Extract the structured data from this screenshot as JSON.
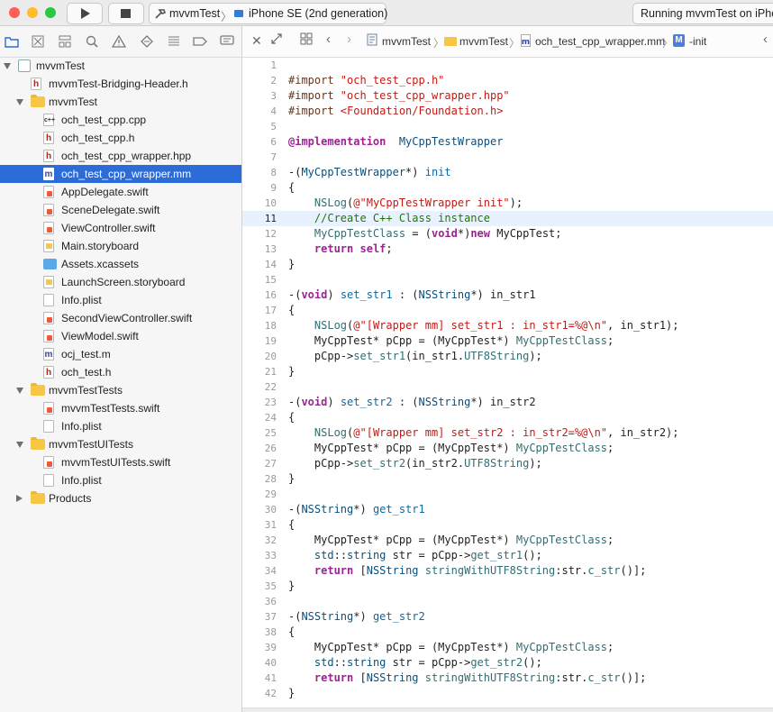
{
  "toolbar": {
    "project": "mvvmTest",
    "device": "iPhone SE (2nd generation)",
    "status": "Running mvvmTest on iPhone SE"
  },
  "navigator": {
    "tabs": [
      "folder-icon",
      "x-square-icon",
      "hierarchy-icon",
      "search-icon",
      "warning-icon",
      "diamond-icon",
      "list-icon",
      "tag-icon",
      "comment-icon"
    ],
    "tree": [
      {
        "label": "mvvmTest",
        "depth": 0,
        "kind": "project",
        "disclosure": "open"
      },
      {
        "label": "mvvmTest-Bridging-Header.h",
        "depth": 1,
        "kind": "h"
      },
      {
        "label": "mvvmTest",
        "depth": 1,
        "kind": "folder",
        "disclosure": "open"
      },
      {
        "label": "och_test_cpp.cpp",
        "depth": 2,
        "kind": "cpp"
      },
      {
        "label": "och_test_cpp.h",
        "depth": 2,
        "kind": "h"
      },
      {
        "label": "och_test_cpp_wrapper.hpp",
        "depth": 2,
        "kind": "h"
      },
      {
        "label": "och_test_cpp_wrapper.mm",
        "depth": 2,
        "kind": "m",
        "selected": true
      },
      {
        "label": "AppDelegate.swift",
        "depth": 2,
        "kind": "swift"
      },
      {
        "label": "SceneDelegate.swift",
        "depth": 2,
        "kind": "swift"
      },
      {
        "label": "ViewController.swift",
        "depth": 2,
        "kind": "swift"
      },
      {
        "label": "Main.storyboard",
        "depth": 2,
        "kind": "storyboard"
      },
      {
        "label": "Assets.xcassets",
        "depth": 2,
        "kind": "xcassets"
      },
      {
        "label": "LaunchScreen.storyboard",
        "depth": 2,
        "kind": "storyboard"
      },
      {
        "label": "Info.plist",
        "depth": 2,
        "kind": "plist"
      },
      {
        "label": "SecondViewController.swift",
        "depth": 2,
        "kind": "swift"
      },
      {
        "label": "ViewModel.swift",
        "depth": 2,
        "kind": "swift"
      },
      {
        "label": "ocj_test.m",
        "depth": 2,
        "kind": "m"
      },
      {
        "label": "och_test.h",
        "depth": 2,
        "kind": "h"
      },
      {
        "label": "mvvmTestTests",
        "depth": 1,
        "kind": "folder",
        "disclosure": "open"
      },
      {
        "label": "mvvmTestTests.swift",
        "depth": 2,
        "kind": "swift"
      },
      {
        "label": "Info.plist",
        "depth": 2,
        "kind": "plist"
      },
      {
        "label": "mvvmTestUITests",
        "depth": 1,
        "kind": "folder",
        "disclosure": "open"
      },
      {
        "label": "mvvmTestUITests.swift",
        "depth": 2,
        "kind": "swift"
      },
      {
        "label": "Info.plist",
        "depth": 2,
        "kind": "plist"
      },
      {
        "label": "Products",
        "depth": 1,
        "kind": "folder",
        "disclosure": "closed"
      }
    ]
  },
  "jumpbar": {
    "items": [
      "mvvmTest",
      "mvvmTest",
      "och_test_cpp_wrapper.mm",
      "-init"
    ],
    "method_badge": "M"
  },
  "editor": {
    "current_line": 11,
    "lines": [
      [],
      [
        [
          "pre",
          "#import "
        ],
        [
          "str",
          "\"och_test_cpp.h\""
        ]
      ],
      [
        [
          "pre",
          "#import "
        ],
        [
          "str",
          "\"och_test_cpp_wrapper.hpp\""
        ]
      ],
      [
        [
          "pre",
          "#import "
        ],
        [
          "str",
          "<Foundation/Foundation.h>"
        ]
      ],
      [],
      [
        [
          "dir",
          "@implementation"
        ],
        [
          "",
          "  "
        ],
        [
          "cls",
          "MyCppTestWrapper"
        ]
      ],
      [],
      [
        [
          "",
          "-("
        ],
        [
          "cls",
          "MyCppTestWrapper"
        ],
        [
          "",
          "*) "
        ],
        [
          "fnc",
          "init"
        ]
      ],
      [
        [
          "",
          "{"
        ]
      ],
      [
        [
          "",
          "    "
        ],
        [
          "fn",
          "NSLog"
        ],
        [
          "",
          "("
        ],
        [
          "str",
          "@\"MyCppTestWrapper init\""
        ],
        [
          "",
          ");"
        ]
      ],
      [
        [
          "",
          "    "
        ],
        [
          "cm",
          "//Create C++ Class instance"
        ]
      ],
      [
        [
          "",
          "    "
        ],
        [
          "fn",
          "MyCppTestClass"
        ],
        [
          "",
          " = ("
        ],
        [
          "kw",
          "void"
        ],
        [
          "",
          "*)"
        ],
        [
          "kw",
          "new"
        ],
        [
          "",
          " MyCppTest;"
        ]
      ],
      [
        [
          "",
          "    "
        ],
        [
          "kw",
          "return"
        ],
        [
          "",
          " "
        ],
        [
          "kw",
          "self"
        ],
        [
          "",
          ";"
        ]
      ],
      [
        [
          "",
          "}"
        ]
      ],
      [],
      [
        [
          "",
          "-("
        ],
        [
          "kw",
          "void"
        ],
        [
          "",
          ") "
        ],
        [
          "fnc",
          "set_str1"
        ],
        [
          "",
          " : ("
        ],
        [
          "cls",
          "NSString"
        ],
        [
          "",
          "*) in_str1"
        ]
      ],
      [
        [
          "",
          "{"
        ]
      ],
      [
        [
          "",
          "    "
        ],
        [
          "fn",
          "NSLog"
        ],
        [
          "",
          "("
        ],
        [
          "str",
          "@\"[Wrapper mm] set_str1 : in_str1=%@\\n\""
        ],
        [
          "",
          ", in_str1);"
        ]
      ],
      [
        [
          "",
          "    MyCppTest* pCpp = (MyCppTest*) "
        ],
        [
          "fn",
          "MyCppTestClass"
        ],
        [
          "",
          ";"
        ]
      ],
      [
        [
          "",
          "    pCpp->"
        ],
        [
          "fn",
          "set_str1"
        ],
        [
          "",
          "(in_str1."
        ],
        [
          "fn",
          "UTF8String"
        ],
        [
          "",
          ");"
        ]
      ],
      [
        [
          "",
          "}"
        ]
      ],
      [],
      [
        [
          "",
          "-("
        ],
        [
          "kw",
          "void"
        ],
        [
          "",
          ") "
        ],
        [
          "fnc",
          "set_str2"
        ],
        [
          "",
          " : ("
        ],
        [
          "cls",
          "NSString"
        ],
        [
          "",
          "*) in_str2"
        ]
      ],
      [
        [
          "",
          "{"
        ]
      ],
      [
        [
          "",
          "    "
        ],
        [
          "fn",
          "NSLog"
        ],
        [
          "",
          "("
        ],
        [
          "str",
          "@\"[Wrapper mm] set_str2 : in_str2=%@\\n\""
        ],
        [
          "",
          ", in_str2);"
        ]
      ],
      [
        [
          "",
          "    MyCppTest* pCpp = (MyCppTest*) "
        ],
        [
          "fn",
          "MyCppTestClass"
        ],
        [
          "",
          ";"
        ]
      ],
      [
        [
          "",
          "    pCpp->"
        ],
        [
          "fn",
          "set_str2"
        ],
        [
          "",
          "(in_str2."
        ],
        [
          "fn",
          "UTF8String"
        ],
        [
          "",
          ");"
        ]
      ],
      [
        [
          "",
          "}"
        ]
      ],
      [],
      [
        [
          "",
          "-("
        ],
        [
          "cls",
          "NSString"
        ],
        [
          "",
          "*) "
        ],
        [
          "fnc",
          "get_str1"
        ]
      ],
      [
        [
          "",
          "{"
        ]
      ],
      [
        [
          "",
          "    MyCppTest* pCpp = (MyCppTest*) "
        ],
        [
          "fn",
          "MyCppTestClass"
        ],
        [
          "",
          ";"
        ]
      ],
      [
        [
          "",
          "    "
        ],
        [
          "cls",
          "std"
        ],
        [
          "",
          "::"
        ],
        [
          "cls",
          "string"
        ],
        [
          "",
          " str = pCpp->"
        ],
        [
          "fn",
          "get_str1"
        ],
        [
          "",
          "();"
        ]
      ],
      [
        [
          "",
          "    "
        ],
        [
          "kw",
          "return"
        ],
        [
          "",
          " ["
        ],
        [
          "cls",
          "NSString"
        ],
        [
          "",
          " "
        ],
        [
          "fn",
          "stringWithUTF8String"
        ],
        [
          "",
          ":str."
        ],
        [
          "fn",
          "c_str"
        ],
        [
          "",
          "()];"
        ]
      ],
      [
        [
          "",
          "}"
        ]
      ],
      [],
      [
        [
          "",
          "-("
        ],
        [
          "cls",
          "NSString"
        ],
        [
          "",
          "*) "
        ],
        [
          "fnc",
          "get_str2"
        ]
      ],
      [
        [
          "",
          "{"
        ]
      ],
      [
        [
          "",
          "    MyCppTest* pCpp = (MyCppTest*) "
        ],
        [
          "fn",
          "MyCppTestClass"
        ],
        [
          "",
          ";"
        ]
      ],
      [
        [
          "",
          "    "
        ],
        [
          "cls",
          "std"
        ],
        [
          "",
          "::"
        ],
        [
          "cls",
          "string"
        ],
        [
          "",
          " str = pCpp->"
        ],
        [
          "fn",
          "get_str2"
        ],
        [
          "",
          "();"
        ]
      ],
      [
        [
          "",
          "    "
        ],
        [
          "kw",
          "return"
        ],
        [
          "",
          " ["
        ],
        [
          "cls",
          "NSString"
        ],
        [
          "",
          " "
        ],
        [
          "fn",
          "stringWithUTF8String"
        ],
        [
          "",
          ":str."
        ],
        [
          "fn",
          "c_str"
        ],
        [
          "",
          "()];"
        ]
      ],
      [
        [
          "",
          "}"
        ]
      ]
    ]
  },
  "colors": {
    "selection": "#2b6cd8",
    "current_line": "#e8f2ff",
    "traffic_close": "#fe5f57",
    "traffic_min": "#febc2e",
    "traffic_max": "#28c840"
  }
}
